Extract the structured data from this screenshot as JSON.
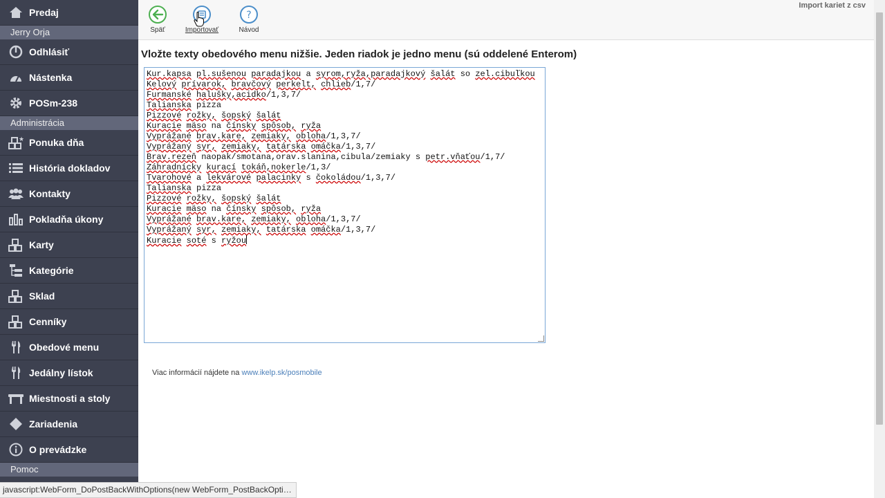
{
  "sidebar": {
    "top_item": {
      "label": "Predaj",
      "icon": "home-icon"
    },
    "user_name": "Jerry Orja",
    "logout": {
      "label": "Odhlásiť",
      "icon": "power-icon"
    },
    "dashboard": {
      "label": "Nástenka",
      "icon": "gauge-icon"
    },
    "device": {
      "label": "POSm-238",
      "icon": "gear-icon"
    },
    "section_admin": "Administrácia",
    "items": [
      {
        "label": "Ponuka dňa",
        "icon": "boxes-star-icon"
      },
      {
        "label": "História dokladov",
        "icon": "list-icon"
      },
      {
        "label": "Kontakty",
        "icon": "users-icon"
      },
      {
        "label": "Pokladňa úkony",
        "icon": "bar-chart-icon"
      },
      {
        "label": "Karty",
        "icon": "boxes-icon"
      },
      {
        "label": "Kategórie",
        "icon": "tree-icon"
      },
      {
        "label": "Sklad",
        "icon": "boxes-icon"
      },
      {
        "label": "Cenníky",
        "icon": "boxes-icon"
      },
      {
        "label": "Obedové menu",
        "icon": "cutlery-icon"
      },
      {
        "label": "Jedálny lístok",
        "icon": "cutlery-icon"
      },
      {
        "label": "Miestnosti a stoly",
        "icon": "table-icon"
      },
      {
        "label": "Zariadenia",
        "icon": "diamond-icon"
      },
      {
        "label": "O prevádzke",
        "icon": "info-icon"
      }
    ],
    "bottom_partial": "Pomoc"
  },
  "toolbar": {
    "back_label": "Späť",
    "import_label": "Importovať",
    "help_label": "Návod",
    "import_csv_label": "Import kariet z csv"
  },
  "main": {
    "heading": "Vložte texty obedového menu nižšie. Jeden riadok je jedno menu (sú oddelené Enterom)",
    "lines": [
      "Kur.kapsa pl.sušenou paradajkou a syrom,ryža,paradajkový šalát so zel.cibuľkou",
      "Kelový prívarok, bravčový perkelt, chlieb/1,7/",
      "Furmanské halušky,acidko/1,3,7/",
      "Talianska pizza",
      "Pizzové rožky, šopský šalát",
      "Kuracie mäso na čínsky spôsob, ryža",
      "Vyprážané brav.kare, zemiaky, obloha/1,3,7/",
      "Vyprážaný syr, zemiaky, tatárska omáčka/1,3,7/",
      "Brav.rezeň naopak/smotana,orav.slanina,cibula/zemiaky s petr.vňaťou/1,7/",
      "Záhradnícky kurací tokáň,nokerle/1,3/",
      "Tvarohové a lekvárové palacinky s čokoládou/1,3,7/",
      "Talianska pizza",
      "Pizzové rožky, šopský šalát",
      "Kuracie mäso na čínsky spôsob, ryža",
      "Vyprážané brav.kare, zemiaky, obloha/1,3,7/",
      "Vyprážaný syr, zemiaky, tatárska omáčka/1,3,7/",
      "Kuracie soté s ryžou"
    ],
    "info_text": "Viac informácií nájdete na ",
    "info_link": "www.ikelp.sk/posmobile"
  },
  "status_bar": "javascript:WebForm_DoPostBackWithOptions(new WebForm_PostBackOption...",
  "colors": {
    "sidebar_bg": "#3d4150",
    "sub_header_bg": "#62677a",
    "back_icon": "#4caf50",
    "toolbar_icon": "#4b8ec9"
  }
}
